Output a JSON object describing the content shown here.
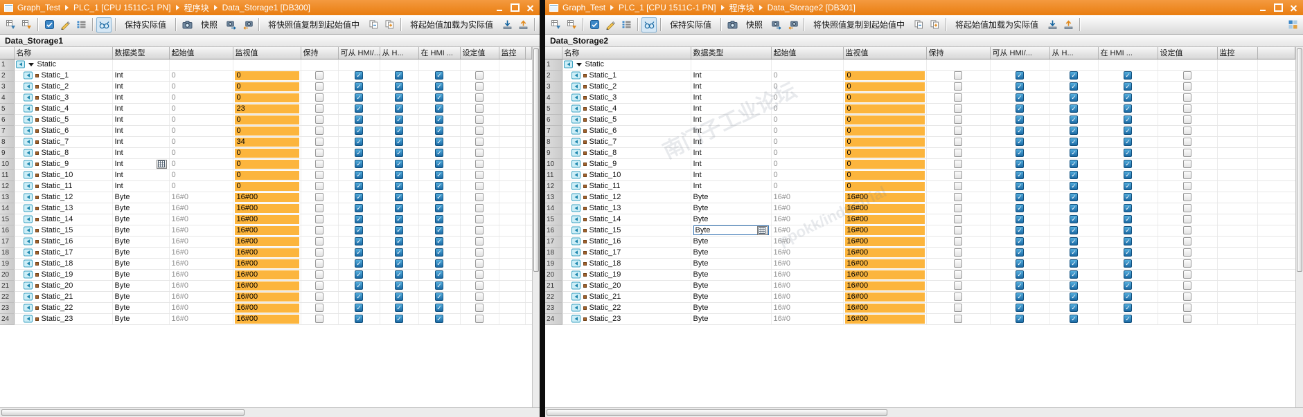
{
  "toolbar_labels": {
    "keep_actual": "保持实际值",
    "snapshot": "快照",
    "copy_snapshot_to_start": "将快照值复制到起始值中",
    "load_start_as_actual": "将起始值加载为实际值"
  },
  "toolbar": {
    "items": [
      {
        "t": "icon",
        "name": "insert-row-icon"
      },
      {
        "t": "icon",
        "name": "append-row-icon"
      },
      {
        "t": "sep"
      },
      {
        "t": "icon",
        "name": "keep-actual-values-icon"
      },
      {
        "t": "icon",
        "name": "edit-pencil-icon"
      },
      {
        "t": "icon",
        "name": "expanded-mode-icon"
      },
      {
        "t": "sep"
      },
      {
        "t": "icon",
        "name": "monitor-all-glasses-icon",
        "pressed": true
      },
      {
        "t": "sep"
      },
      {
        "t": "btn",
        "name": "keep-actual-values-button",
        "bind": "keep_actual"
      },
      {
        "t": "sep"
      },
      {
        "t": "icon",
        "name": "snapshot-camera-icon"
      },
      {
        "t": "btn",
        "name": "snapshot-button",
        "bind": "snapshot"
      },
      {
        "t": "icon",
        "name": "copy-snapshot-icon"
      },
      {
        "t": "icon",
        "name": "copy-snapshot-all-icon"
      },
      {
        "t": "sep"
      },
      {
        "t": "btn",
        "name": "copy-snapshot-to-start-button",
        "bind": "copy_snapshot_to_start"
      },
      {
        "t": "icon",
        "name": "copy-start-values-icon"
      },
      {
        "t": "icon",
        "name": "copy-setpoints-icon"
      },
      {
        "t": "sep"
      },
      {
        "t": "btn",
        "name": "load-start-as-actual-button",
        "bind": "load_start_as_actual"
      },
      {
        "t": "icon",
        "name": "download-values-icon"
      },
      {
        "t": "icon",
        "name": "upload-values-icon"
      },
      {
        "t": "sep"
      },
      {
        "t": "spacer"
      },
      {
        "t": "icon",
        "name": "detail-view-icon"
      }
    ]
  },
  "columns": [
    "",
    "名称",
    "数据类型",
    "起始值",
    "监视值",
    "保持",
    "可从 HMI/...",
    "从 H...",
    "在 HMI ...",
    "设定值",
    "监控"
  ],
  "checkbox_columns": [
    {
      "key": "retain",
      "label": "保持",
      "checked": false
    },
    {
      "key": "accessible_from_hmi",
      "label": "可从 HMI/...",
      "checked": true
    },
    {
      "key": "writable_from_hmi",
      "label": "从 H...",
      "checked": true
    },
    {
      "key": "visible_in_hmi",
      "label": "在 HMI ...",
      "checked": true
    },
    {
      "key": "setpoint",
      "label": "设定值",
      "checked": false
    }
  ],
  "watermark": {
    "line1": "南门子工业论坛",
    "line2": "ppokk/industrial"
  },
  "panels": [
    {
      "side": "left",
      "breadcrumb": [
        "Graph_Test",
        "PLC_1 [CPU 1511C-1 PN]",
        "程序块",
        "Data_Storage1 [DB300]"
      ],
      "window_buttons": [
        "minimize",
        "restore",
        "close"
      ],
      "doc_title": "Data_Storage1",
      "rows": [
        {
          "num": "1",
          "name": "Static",
          "group": true
        },
        {
          "num": "2",
          "name": "Static_1",
          "type": "Int",
          "start": "0",
          "monitor": "0"
        },
        {
          "num": "3",
          "name": "Static_2",
          "type": "Int",
          "start": "0",
          "monitor": "0"
        },
        {
          "num": "4",
          "name": "Static_3",
          "type": "Int",
          "start": "0",
          "monitor": "0"
        },
        {
          "num": "5",
          "name": "Static_4",
          "type": "Int",
          "start": "0",
          "monitor": "23"
        },
        {
          "num": "6",
          "name": "Static_5",
          "type": "Int",
          "start": "0",
          "monitor": "0"
        },
        {
          "num": "7",
          "name": "Static_6",
          "type": "Int",
          "start": "0",
          "monitor": "0"
        },
        {
          "num": "8",
          "name": "Static_7",
          "type": "Int",
          "start": "0",
          "monitor": "34"
        },
        {
          "num": "9",
          "name": "Static_8",
          "type": "Int",
          "start": "0",
          "monitor": "0"
        },
        {
          "num": "10",
          "name": "Static_9",
          "type": "Int",
          "start": "0",
          "monitor": "0",
          "type_edit": "button"
        },
        {
          "num": "11",
          "name": "Static_10",
          "type": "Int",
          "start": "0",
          "monitor": "0"
        },
        {
          "num": "12",
          "name": "Static_11",
          "type": "Int",
          "start": "0",
          "monitor": "0"
        },
        {
          "num": "13",
          "name": "Static_12",
          "type": "Byte",
          "start": "16#0",
          "monitor": "16#00"
        },
        {
          "num": "14",
          "name": "Static_13",
          "type": "Byte",
          "start": "16#0",
          "monitor": "16#00"
        },
        {
          "num": "15",
          "name": "Static_14",
          "type": "Byte",
          "start": "16#0",
          "monitor": "16#00"
        },
        {
          "num": "16",
          "name": "Static_15",
          "type": "Byte",
          "start": "16#0",
          "monitor": "16#00"
        },
        {
          "num": "17",
          "name": "Static_16",
          "type": "Byte",
          "start": "16#0",
          "monitor": "16#00"
        },
        {
          "num": "18",
          "name": "Static_17",
          "type": "Byte",
          "start": "16#0",
          "monitor": "16#00"
        },
        {
          "num": "19",
          "name": "Static_18",
          "type": "Byte",
          "start": "16#0",
          "monitor": "16#00"
        },
        {
          "num": "20",
          "name": "Static_19",
          "type": "Byte",
          "start": "16#0",
          "monitor": "16#00"
        },
        {
          "num": "21",
          "name": "Static_20",
          "type": "Byte",
          "start": "16#0",
          "monitor": "16#00"
        },
        {
          "num": "22",
          "name": "Static_21",
          "type": "Byte",
          "start": "16#0",
          "monitor": "16#00"
        },
        {
          "num": "23",
          "name": "Static_22",
          "type": "Byte",
          "start": "16#0",
          "monitor": "16#00"
        },
        {
          "num": "24",
          "name": "Static_23",
          "type": "Byte",
          "start": "16#0",
          "monitor": "16#00"
        }
      ]
    },
    {
      "side": "right",
      "breadcrumb": [
        "Graph_Test",
        "PLC_1 [CPU 1511C-1 PN]",
        "程序块",
        "Data_Storage2 [DB301]"
      ],
      "window_buttons": [
        "minimize",
        "restore",
        "close"
      ],
      "doc_title": "Data_Storage2",
      "rows": [
        {
          "num": "1",
          "name": "Static",
          "group": true
        },
        {
          "num": "2",
          "name": "Static_1",
          "type": "Int",
          "start": "0",
          "monitor": "0"
        },
        {
          "num": "3",
          "name": "Static_2",
          "type": "Int",
          "start": "0",
          "monitor": "0"
        },
        {
          "num": "4",
          "name": "Static_3",
          "type": "Int",
          "start": "0",
          "monitor": "0"
        },
        {
          "num": "5",
          "name": "Static_4",
          "type": "Int",
          "start": "0",
          "monitor": "0"
        },
        {
          "num": "6",
          "name": "Static_5",
          "type": "Int",
          "start": "0",
          "monitor": "0"
        },
        {
          "num": "7",
          "name": "Static_6",
          "type": "Int",
          "start": "0",
          "monitor": "0"
        },
        {
          "num": "8",
          "name": "Static_7",
          "type": "Int",
          "start": "0",
          "monitor": "0"
        },
        {
          "num": "9",
          "name": "Static_8",
          "type": "Int",
          "start": "0",
          "monitor": "0"
        },
        {
          "num": "10",
          "name": "Static_9",
          "type": "Int",
          "start": "0",
          "monitor": "0"
        },
        {
          "num": "11",
          "name": "Static_10",
          "type": "Int",
          "start": "0",
          "monitor": "0"
        },
        {
          "num": "12",
          "name": "Static_11",
          "type": "Int",
          "start": "0",
          "monitor": "0"
        },
        {
          "num": "13",
          "name": "Static_12",
          "type": "Byte",
          "start": "16#0",
          "monitor": "16#00"
        },
        {
          "num": "14",
          "name": "Static_13",
          "type": "Byte",
          "start": "16#0",
          "monitor": "16#00"
        },
        {
          "num": "15",
          "name": "Static_14",
          "type": "Byte",
          "start": "16#0",
          "monitor": "16#00"
        },
        {
          "num": "16",
          "name": "Static_15",
          "type": "Byte",
          "start": "16#0",
          "monitor": "16#00",
          "type_edit": "combo"
        },
        {
          "num": "17",
          "name": "Static_16",
          "type": "Byte",
          "start": "16#0",
          "monitor": "16#00"
        },
        {
          "num": "18",
          "name": "Static_17",
          "type": "Byte",
          "start": "16#0",
          "monitor": "16#00"
        },
        {
          "num": "19",
          "name": "Static_18",
          "type": "Byte",
          "start": "16#0",
          "monitor": "16#00"
        },
        {
          "num": "20",
          "name": "Static_19",
          "type": "Byte",
          "start": "16#0",
          "monitor": "16#00"
        },
        {
          "num": "21",
          "name": "Static_20",
          "type": "Byte",
          "start": "16#0",
          "monitor": "16#00"
        },
        {
          "num": "22",
          "name": "Static_21",
          "type": "Byte",
          "start": "16#0",
          "monitor": "16#00"
        },
        {
          "num": "23",
          "name": "Static_22",
          "type": "Byte",
          "start": "16#0",
          "monitor": "16#00"
        },
        {
          "num": "24",
          "name": "Static_23",
          "type": "Byte",
          "start": "16#0",
          "monitor": "16#00"
        }
      ]
    }
  ]
}
